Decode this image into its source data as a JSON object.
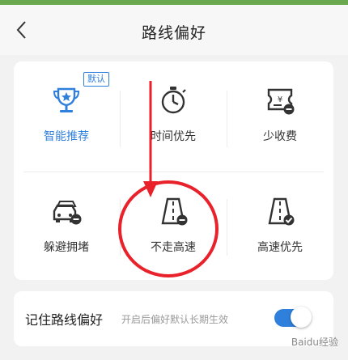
{
  "header": {
    "title": "路线偏好",
    "back_icon": "chevron-left-icon"
  },
  "options": [
    {
      "label": "智能推荐",
      "icon": "trophy-icon",
      "badge": "默认",
      "selected": true
    },
    {
      "label": "时间优先",
      "icon": "stopwatch-icon",
      "selected": false
    },
    {
      "label": "少收费",
      "icon": "toll-ticket-icon",
      "selected": false
    },
    {
      "label": "躲避拥堵",
      "icon": "cars-icon",
      "selected": false
    },
    {
      "label": "不走高速",
      "icon": "highway-minus-icon",
      "selected": false
    },
    {
      "label": "高速优先",
      "icon": "highway-check-icon",
      "selected": false
    }
  ],
  "remember": {
    "label": "记住路线偏好",
    "hint": "开启后偏好默认长期生效",
    "enabled": true
  },
  "watermark": "Baidu经验",
  "colors": {
    "accent": "#2f7fdc",
    "annotation": "#e8212a",
    "top_bar": "#6aa84f"
  }
}
